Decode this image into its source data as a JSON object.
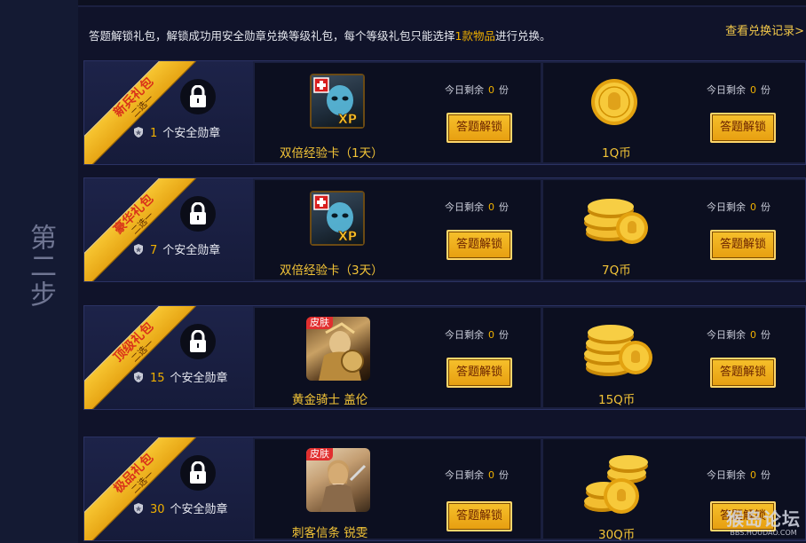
{
  "step_label": "第二步",
  "header": {
    "note_before": "答题解锁礼包，解锁成功用安全勋章兑换等级礼包，每个等级礼包只能选择",
    "note_highlight": "1款物品",
    "note_after": "进行兑换。",
    "history_link": "查看兑换记录>"
  },
  "colors": {
    "accent_gold": "#f0b000",
    "button_gold": "#f6c02b",
    "ribbon_red": "#d9331a"
  },
  "common": {
    "remain_prefix": "今日剩余",
    "remain_suffix": "份",
    "unlock_label": "答题解锁",
    "medal_suffix": "个安全勋章",
    "skin_tag": "皮肤"
  },
  "packs": [
    {
      "ribbon_name": "新兵礼包",
      "ribbon_sub": "二选一",
      "medal_count": "1",
      "left_item": {
        "name": "双倍经验卡（1天）",
        "kind": "xp-card",
        "remaining": "0"
      },
      "right_item": {
        "name": "1Q币",
        "kind": "qcoin-1",
        "remaining": "0"
      }
    },
    {
      "ribbon_name": "豪华礼包",
      "ribbon_sub": "二选一",
      "medal_count": "7",
      "left_item": {
        "name": "双倍经验卡（3天）",
        "kind": "xp-card",
        "remaining": "0"
      },
      "right_item": {
        "name": "7Q币",
        "kind": "qcoin-stack",
        "remaining": "0"
      }
    },
    {
      "ribbon_name": "顶级礼包",
      "ribbon_sub": "二选一",
      "medal_count": "15",
      "left_item": {
        "name": "黄金骑士 盖伦",
        "kind": "skin",
        "remaining": "0"
      },
      "right_item": {
        "name": "15Q币",
        "kind": "qcoin-stack",
        "remaining": "0"
      }
    },
    {
      "ribbon_name": "极品礼包",
      "ribbon_sub": "二选一",
      "medal_count": "30",
      "left_item": {
        "name": "刺客信条 锐雯",
        "kind": "skin",
        "remaining": "0"
      },
      "right_item": {
        "name": "30Q币",
        "kind": "qcoin-pile",
        "remaining": "0"
      }
    }
  ],
  "watermark": {
    "line1": "猴岛论坛",
    "line2": "BBS.HOUDAO.COM"
  }
}
